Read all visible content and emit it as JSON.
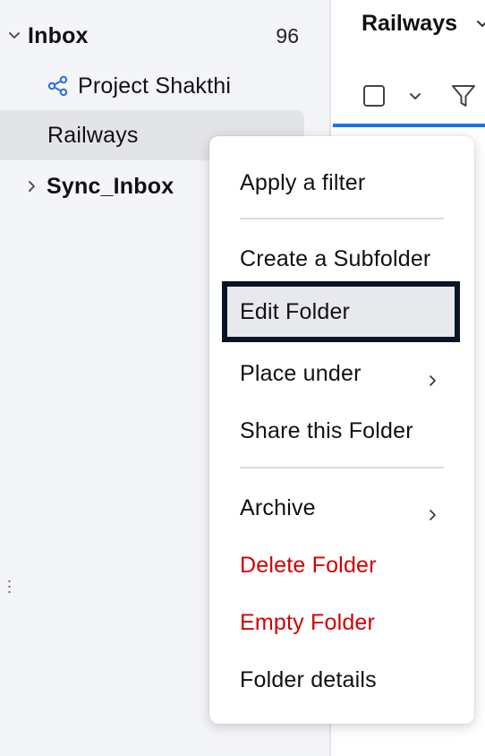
{
  "sidebar": {
    "inbox": {
      "label": "Inbox",
      "count": "96"
    },
    "project": {
      "label": "Project Shakthi",
      "icon": "share-icon",
      "icon_color": "#2b6fd6"
    },
    "railways": {
      "label": "Railways"
    },
    "sync_inbox": {
      "label": "Sync_Inbox"
    }
  },
  "list_header": {
    "title": "Railways",
    "accent_color": "#1a73e8"
  },
  "context_menu": {
    "apply_filter": "Apply a filter",
    "create_subfolder": "Create a Subfolder",
    "edit_folder": "Edit Folder",
    "place_under": "Place under",
    "share_folder": "Share this Folder",
    "archive": "Archive",
    "delete_folder": "Delete Folder",
    "empty_folder": "Empty Folder",
    "folder_details": "Folder details",
    "danger_color": "#d20000"
  }
}
